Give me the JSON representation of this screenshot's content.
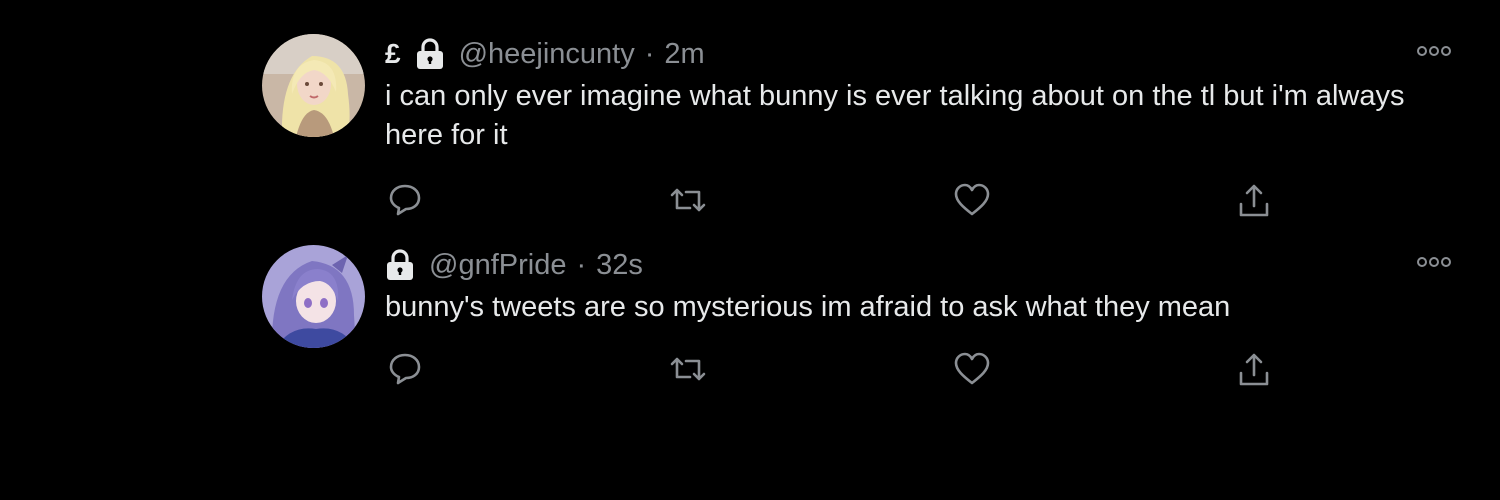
{
  "tweets": [
    {
      "prefix_symbol": "£",
      "handle": "@heejincunty",
      "separator": "·",
      "time": "2m",
      "text": "i can only ever imagine what bunny is ever talking about on the tl but i'm always here for it",
      "avatar_icon": "avatar-blonde-woman",
      "actions": [
        "reply-icon",
        "retweet-icon",
        "like-icon",
        "share-icon"
      ]
    },
    {
      "handle": "@gnfPride",
      "separator": "·",
      "time": "32s",
      "text": "bunny's tweets are so mysterious im afraid to ask what they mean",
      "avatar_icon": "avatar-anime-girl",
      "actions": [
        "reply-icon",
        "retweet-icon",
        "like-icon",
        "share-icon"
      ]
    }
  ],
  "colors": {
    "background": "#000000",
    "text": "#e7e9ea",
    "muted": "#71767b"
  }
}
